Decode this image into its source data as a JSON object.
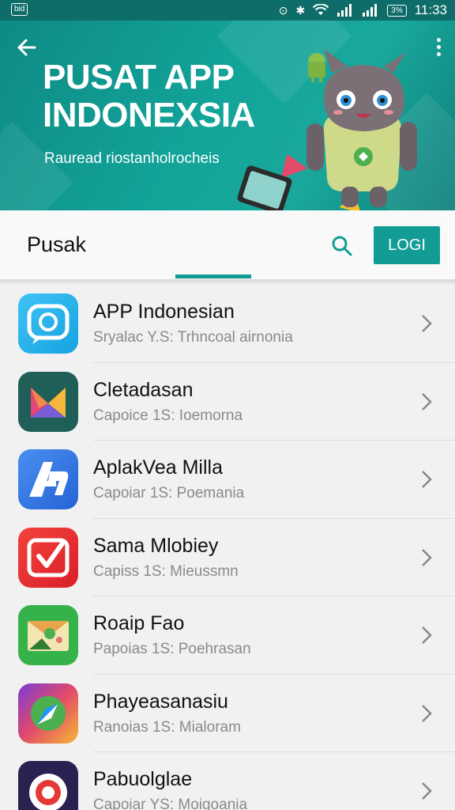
{
  "status_bar": {
    "left_badge": "bid",
    "battery": "3%",
    "time": "11:33"
  },
  "banner": {
    "title_line1": "PUSAT APP",
    "title_line2": "INDONEXSIA",
    "subtitle": "Rauread riostanholrocheis"
  },
  "toolbar": {
    "title": "Pusak",
    "login_label": "LOGI"
  },
  "colors": {
    "accent": "#139c95",
    "banner": "#12a399"
  },
  "apps": [
    {
      "name": "APP Indonesian",
      "subtitle": "Sryalac Y.S: Trhncoal airnonia",
      "icon": "chat-bubble-app-icon"
    },
    {
      "name": "Cletadasan",
      "subtitle": "Capoice 1S: Ioemorna",
      "icon": "gradient-ribbon-app-icon"
    },
    {
      "name": "AplakVea Milla",
      "subtitle": "Capoiar 1S: Poemania",
      "icon": "letter-a-app-icon"
    },
    {
      "name": "Sama Mlobiey",
      "subtitle": "Capiss 1S: Mieussmn",
      "icon": "play-swoosh-app-icon"
    },
    {
      "name": "Roaip Fao",
      "subtitle": "Papoias 1S: Poehrasan",
      "icon": "photo-envelope-app-icon"
    },
    {
      "name": "Phayeasanasiu",
      "subtitle": "Ranoias 1S: Mialoram",
      "icon": "compass-app-icon"
    },
    {
      "name": "Pabuolglae",
      "subtitle": "Capoiar YS: Moigoania",
      "icon": "target-app-icon"
    }
  ]
}
